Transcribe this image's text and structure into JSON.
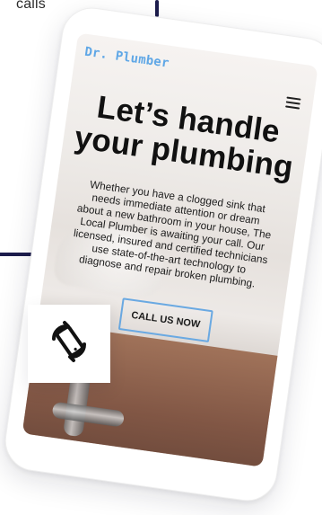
{
  "top_snippet": "calls",
  "phone": {
    "brand": "Dr. Plumber",
    "hero": {
      "title_line_1": "Let’s handle",
      "title_line_2": "your plumbing",
      "body_lines": [
        "Whether you have a clogged sink that",
        "needs immediate attention or dream",
        "about a new bathroom in your house, The",
        "Local Plumber is awaiting your call. Our",
        "licensed, insured and certified technicians",
        "use state-of-the-art technology to",
        "diagnose and repair broken plumbing."
      ],
      "cta_label": "CALL US NOW"
    },
    "menu_icon": "hamburger-menu-icon"
  },
  "rotate_card": {
    "icon": "screen-rotation-icon"
  },
  "colors": {
    "navy_lines": "#1c1c4c",
    "brand_blue": "#5fa7e6",
    "cta_border": "#6aa9e2"
  }
}
